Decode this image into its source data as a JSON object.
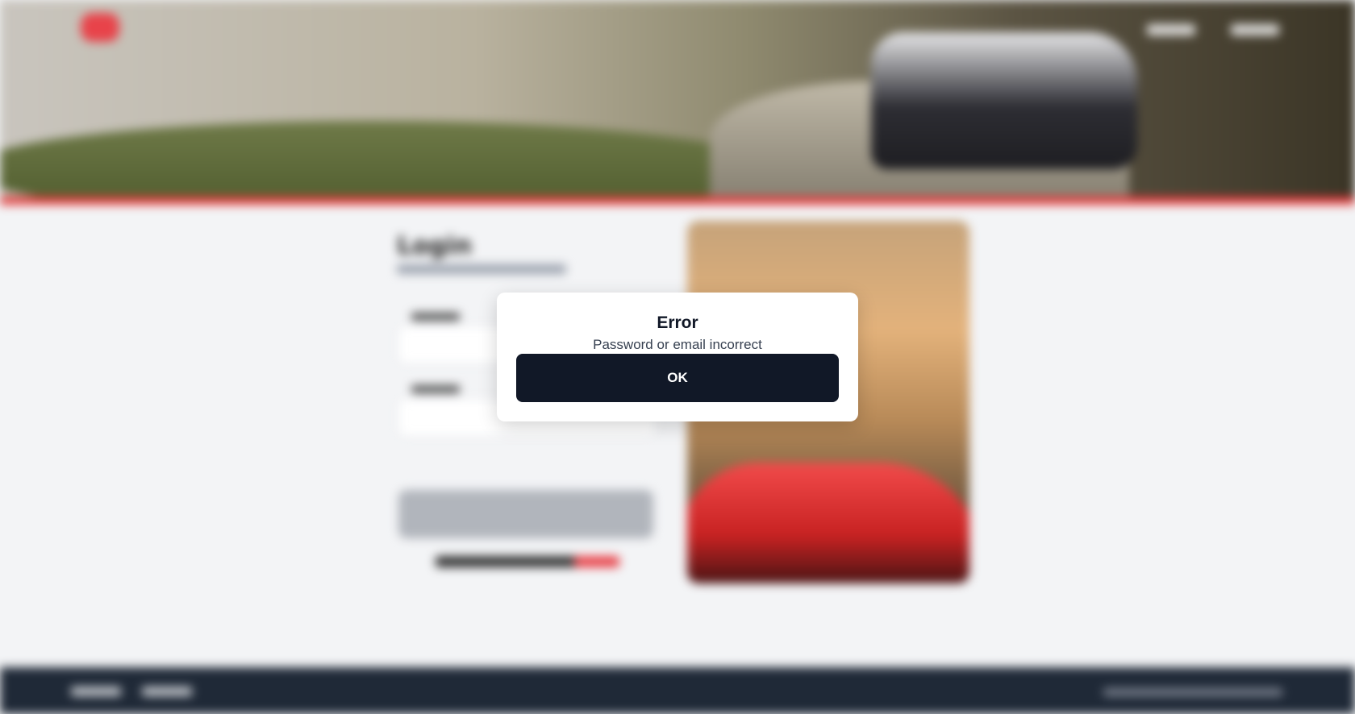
{
  "background_page": {
    "login_title": "Login"
  },
  "modal": {
    "title": "Error",
    "message": "Password or email incorrect",
    "ok_label": "OK"
  },
  "colors": {
    "accent_red": "#e8434a",
    "modal_button": "#111827",
    "footer_bg": "#1f2937"
  }
}
